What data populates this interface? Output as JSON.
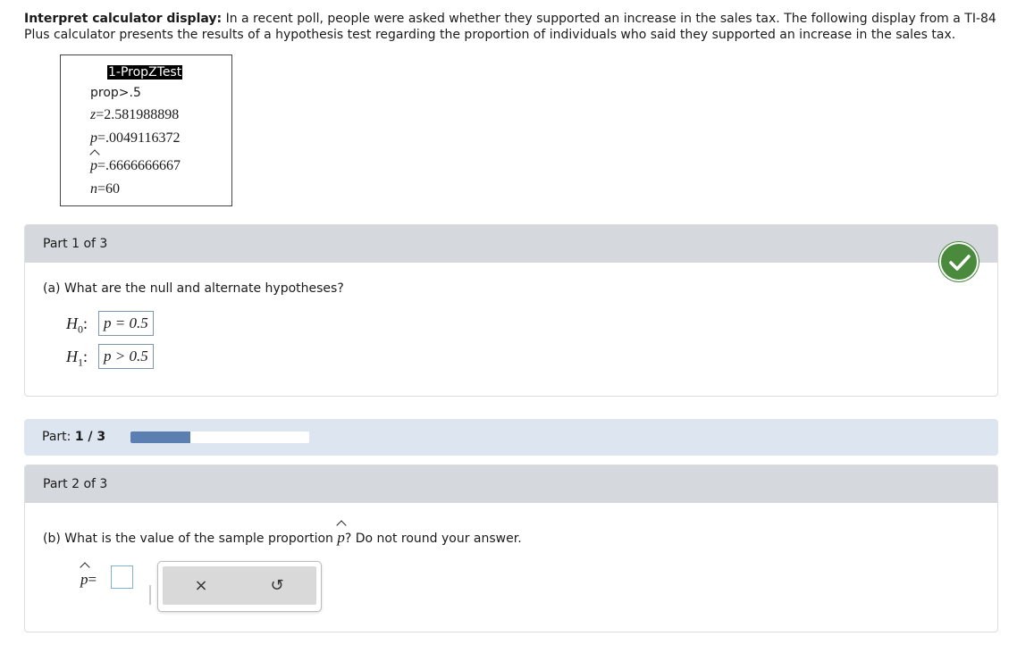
{
  "intro": {
    "bold": "Interpret calculator display:",
    "text": " In a recent poll, people were asked whether they supported an increase in the sales tax. The following display from a TI-84 Plus calculator presents the results of a hypothesis test regarding the proportion of individuals who said they supported an increase in the sales tax."
  },
  "calculator": {
    "title": "1-PropZTest",
    "prop_label": "prop",
    "prop_rel": ">",
    "prop_value": ".5",
    "z_var": "z",
    "z_value": "2.581988898",
    "p_var": "p",
    "p_value": ".0049116372",
    "phat_var": "p",
    "phat_value": ".6666666667",
    "n_var": "n",
    "n_value": "60",
    "eq": "="
  },
  "part1": {
    "header": "Part 1 of 3",
    "question": "(a) What are the null and alternate hypotheses?",
    "h0_label": "H",
    "h0_sub": "0",
    "h1_label": "H",
    "h1_sub": "1",
    "colon": ":",
    "h0_answer": "p = 0.5",
    "h1_answer": "p > 0.5",
    "status_icon": "checkmark-icon",
    "status_color": "#4a8a3d"
  },
  "progress": {
    "label": "Part: ",
    "current": "1 / 3",
    "fraction": 0.333,
    "color": "#5a7fb0"
  },
  "part2": {
    "header": "Part 2 of 3",
    "question_pre": "(b) What is the value of the sample proportion ",
    "question_var": "p",
    "question_post": "? Do not round your answer.",
    "answer_label_var": "p",
    "answer_eq": "=",
    "answer_value": "",
    "clear_icon": "close-icon",
    "undo_icon": "undo-icon",
    "clear_symbol": "×",
    "undo_symbol": "↺"
  }
}
